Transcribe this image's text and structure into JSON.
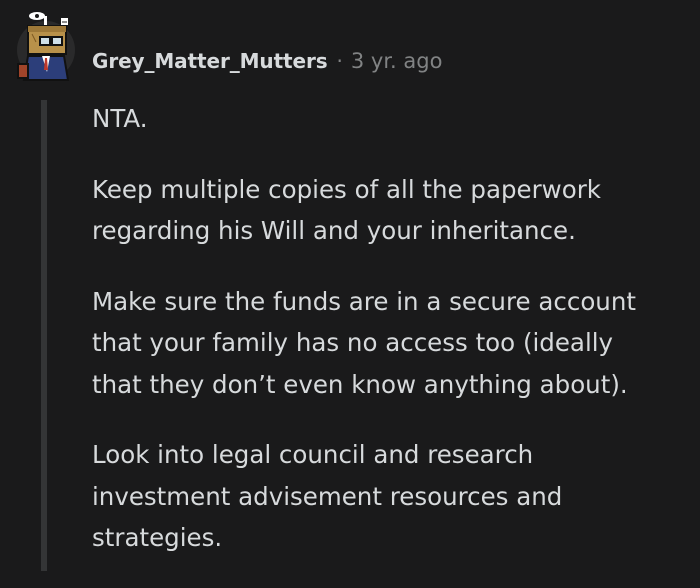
{
  "comment": {
    "author": "Grey_Matter_Mutters",
    "separator": "·",
    "timestamp": "3 yr. ago",
    "paragraphs": [
      "NTA.",
      "Keep multiple copies of all the paperwork\nregarding his Will and your inheritance.",
      "Make sure the funds are in a secure account\nthat your family has no access too (ideally\nthat they don’t even know anything about).",
      "Look into legal council and research\ninvestment advisement resources and\nstrategies."
    ]
  },
  "colors": {
    "background": "#1a1a1b",
    "text": "#d7dadc",
    "meta": "#818384",
    "thread_line": "#343536"
  },
  "icons": {
    "avatar": "avatar-icon"
  }
}
